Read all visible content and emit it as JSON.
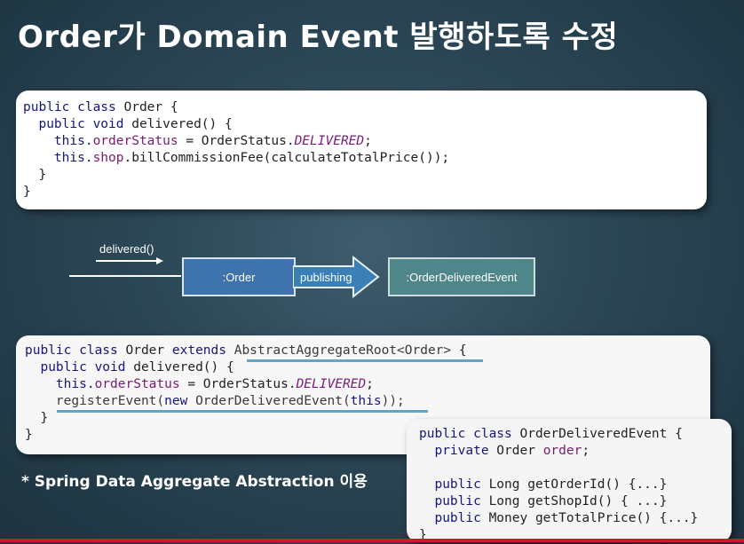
{
  "title": "Order가 Domain Event 발행하도록 수정",
  "code_top": {
    "l1_a": "public class",
    "l1_b": " Order {",
    "l2_a": "  public void",
    "l2_b": " delivered() {",
    "l3_a": "    this.",
    "l3_b": "orderStatus",
    "l3_c": " = OrderStatus.",
    "l3_d": "DELIVERED",
    "l3_e": ";",
    "l4_a": "    this.",
    "l4_b": "shop",
    "l4_c": ".billCommissionFee(calculateTotalPrice());",
    "l5": "  }",
    "l6": "}"
  },
  "diagram": {
    "call_label": "delivered()",
    "source_node": ":Order",
    "arrow_label": "publishing",
    "target_node": ":OrderDeliveredEvent"
  },
  "code_bottom": {
    "l1_a": "public class",
    "l1_b": " Order ",
    "l1_c": "extends",
    "l1_d": " AbstractAggregateRoot<Order>",
    "l1_e": " {",
    "l2_a": "  public void",
    "l2_b": " delivered() {",
    "l3_a": "    this.",
    "l3_b": "orderStatus",
    "l3_c": " = OrderStatus.",
    "l3_d": "DELIVERED",
    "l3_e": ";",
    "l4_a": "    registerEvent(",
    "l4_b": "new",
    "l4_c": " OrderDeliveredEvent(",
    "l4_d": "this",
    "l4_e": "));",
    "l5": "  }",
    "l6": "}"
  },
  "code_event": {
    "l1_a": "public class",
    "l1_b": " OrderDeliveredEvent {",
    "l2_a": "  private",
    "l2_b": " Order ",
    "l2_c": "order",
    "l2_d": ";",
    "l3": "",
    "l4_a": "  public",
    "l4_b": " Long getOrderId() {...}",
    "l5_a": "  public",
    "l5_b": " Long getShopId() { ...}",
    "l6_a": "  public",
    "l6_b": " Money getTotalPrice() {...}",
    "l7": "}"
  },
  "note": "* Spring Data Aggregate Abstraction 이용",
  "colors": {
    "background": "#2b4655",
    "order_node": "#3e73ad",
    "event_node": "#4e868a",
    "arrow": "#3a7fb5",
    "underline": "#5fa6c8"
  }
}
